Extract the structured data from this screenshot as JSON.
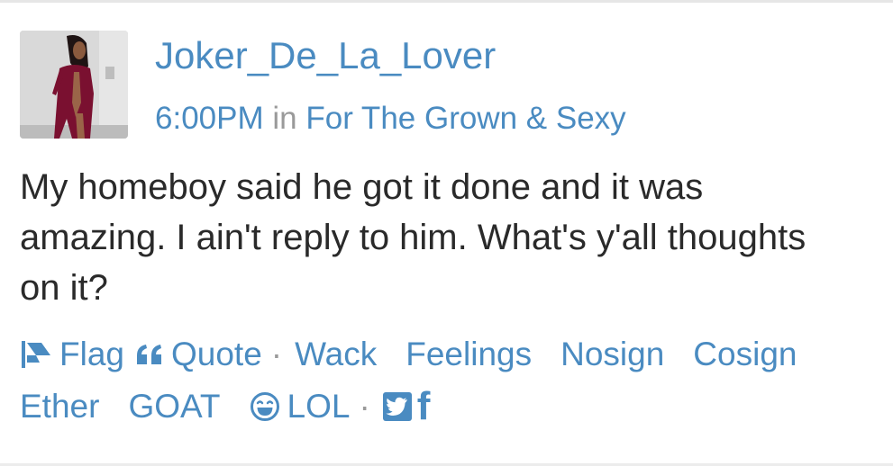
{
  "post": {
    "username": "Joker_De_La_Lover",
    "time": "6:00PM",
    "in_word": "in",
    "board": "For The Grown & Sexy",
    "body_lines": [
      "My homeboy said he got it done and it was",
      "amazing. I ain't reply to him. What's y'all thoughts",
      "on it?"
    ]
  },
  "actions": {
    "flag": "Flag",
    "quote": "Quote",
    "sep": "·",
    "wack": "Wack",
    "feelings": "Feelings",
    "nosign": "Nosign",
    "cosign": "Cosign",
    "ether": "Ether",
    "goat": "GOAT",
    "lol": "LOL"
  },
  "icons": {
    "flag": "flag-icon",
    "quote": "quote-icon",
    "lol": "laughing-face-icon",
    "twitter": "twitter-icon",
    "facebook": "facebook-icon"
  },
  "colors": {
    "link": "#4a8bc1",
    "muted": "#9a9a9a",
    "text": "#2a2a2a"
  }
}
